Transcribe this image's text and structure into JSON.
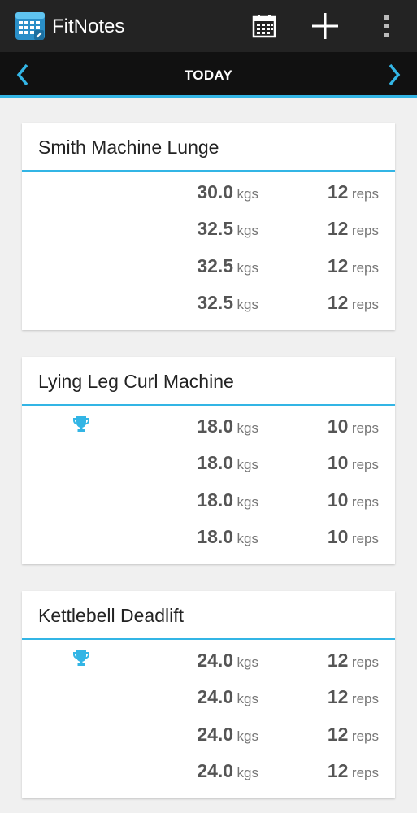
{
  "app": {
    "title": "FitNotes",
    "logo_icon": "fitnotes-calendar-logo-icon"
  },
  "actionbar": {
    "calendar_icon": "calendar-icon",
    "add_icon": "plus-icon",
    "overflow_icon": "overflow-menu-icon"
  },
  "datebar": {
    "label": "TODAY",
    "prev_icon": "chevron-left-icon",
    "next_icon": "chevron-right-icon"
  },
  "colors": {
    "accent": "#33b5e5",
    "actionbar": "#232323",
    "datebar": "#111111",
    "background": "#f0f0f0"
  },
  "workout": {
    "exercises": [
      {
        "name": "Smith Machine Lunge",
        "sets": [
          {
            "weight": "30.0",
            "weight_unit": "kgs",
            "reps": "12",
            "reps_unit": "reps",
            "record": false
          },
          {
            "weight": "32.5",
            "weight_unit": "kgs",
            "reps": "12",
            "reps_unit": "reps",
            "record": false
          },
          {
            "weight": "32.5",
            "weight_unit": "kgs",
            "reps": "12",
            "reps_unit": "reps",
            "record": false
          },
          {
            "weight": "32.5",
            "weight_unit": "kgs",
            "reps": "12",
            "reps_unit": "reps",
            "record": false
          }
        ]
      },
      {
        "name": "Lying Leg Curl Machine",
        "sets": [
          {
            "weight": "18.0",
            "weight_unit": "kgs",
            "reps": "10",
            "reps_unit": "reps",
            "record": true
          },
          {
            "weight": "18.0",
            "weight_unit": "kgs",
            "reps": "10",
            "reps_unit": "reps",
            "record": false
          },
          {
            "weight": "18.0",
            "weight_unit": "kgs",
            "reps": "10",
            "reps_unit": "reps",
            "record": false
          },
          {
            "weight": "18.0",
            "weight_unit": "kgs",
            "reps": "10",
            "reps_unit": "reps",
            "record": false
          }
        ]
      },
      {
        "name": "Kettlebell Deadlift",
        "sets": [
          {
            "weight": "24.0",
            "weight_unit": "kgs",
            "reps": "12",
            "reps_unit": "reps",
            "record": true
          },
          {
            "weight": "24.0",
            "weight_unit": "kgs",
            "reps": "12",
            "reps_unit": "reps",
            "record": false
          },
          {
            "weight": "24.0",
            "weight_unit": "kgs",
            "reps": "12",
            "reps_unit": "reps",
            "record": false
          },
          {
            "weight": "24.0",
            "weight_unit": "kgs",
            "reps": "12",
            "reps_unit": "reps",
            "record": false
          }
        ]
      }
    ],
    "record_icon": "trophy-icon"
  }
}
